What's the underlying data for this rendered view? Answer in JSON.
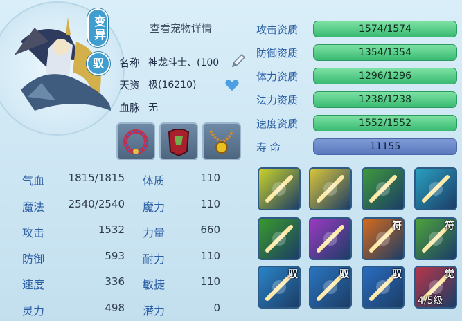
{
  "pet": {
    "badge_variant": "变异",
    "badge_ride": "驭",
    "detail_link": "查看宠物详情",
    "name_label": "名称",
    "name_value": "神龙斗士、(100",
    "talent_label": "天资",
    "talent_value": "极(16210)",
    "bloodline_label": "血脉",
    "bloodline_value": "无"
  },
  "equipment": [
    {
      "name": "collar-equipment"
    },
    {
      "name": "armor-equipment"
    },
    {
      "name": "necklace-equipment"
    }
  ],
  "stats_left": [
    {
      "label": "气血",
      "value": "1815/1815"
    },
    {
      "label": "魔法",
      "value": "2540/2540"
    },
    {
      "label": "攻击",
      "value": "1532"
    },
    {
      "label": "防御",
      "value": "593"
    },
    {
      "label": "速度",
      "value": "336"
    },
    {
      "label": "灵力",
      "value": "498"
    }
  ],
  "stats_right": [
    {
      "label": "体质",
      "value": "110"
    },
    {
      "label": "魔力",
      "value": "110"
    },
    {
      "label": "力量",
      "value": "660"
    },
    {
      "label": "耐力",
      "value": "110"
    },
    {
      "label": "敏捷",
      "value": "110"
    },
    {
      "label": "潜力",
      "value": "0"
    }
  ],
  "aptitudes": [
    {
      "label": "攻击资质",
      "value": "1574/1574",
      "fill": 1.0
    },
    {
      "label": "防御资质",
      "value": "1354/1354",
      "fill": 1.0
    },
    {
      "label": "体力资质",
      "value": "1296/1296",
      "fill": 1.0
    },
    {
      "label": "法力资质",
      "value": "1238/1238",
      "fill": 1.0
    },
    {
      "label": "速度资质",
      "value": "1552/1552",
      "fill": 1.0
    }
  ],
  "lifespan": {
    "label": "寿      命",
    "value": "11155"
  },
  "skills": [
    {
      "name": "flaming-sword-skill",
      "tag": "",
      "level": "",
      "color": "#c9d12a"
    },
    {
      "name": "silver-sword-skill",
      "tag": "",
      "level": "",
      "color": "#d8c43a"
    },
    {
      "name": "shadow-strike-skill",
      "tag": "",
      "level": "",
      "color": "#3e9a3a"
    },
    {
      "name": "water-spirit-skill",
      "tag": "",
      "level": "",
      "color": "#2aa0c0"
    },
    {
      "name": "green-warrior-skill",
      "tag": "",
      "level": "",
      "color": "#3a9a2a"
    },
    {
      "name": "lightning-blade-skill",
      "tag": "",
      "level": "",
      "color": "#9a3ac0"
    },
    {
      "name": "red-talisman-skill",
      "tag": "符",
      "level": "",
      "color": "#d86a1a"
    },
    {
      "name": "green-talisman-skill",
      "tag": "符",
      "level": "",
      "color": "#4ea33a"
    },
    {
      "name": "ride-flight-skill",
      "tag": "驭",
      "level": "",
      "color": "#2a84c8"
    },
    {
      "name": "ride-blade-skill",
      "tag": "驭",
      "level": "",
      "color": "#2a74c0"
    },
    {
      "name": "ride-dash-skill",
      "tag": "驭",
      "level": "",
      "color": "#2a6cc0"
    },
    {
      "name": "awaken-skill",
      "tag": "觉",
      "level": "4/5级",
      "color": "#b8364a"
    }
  ]
}
